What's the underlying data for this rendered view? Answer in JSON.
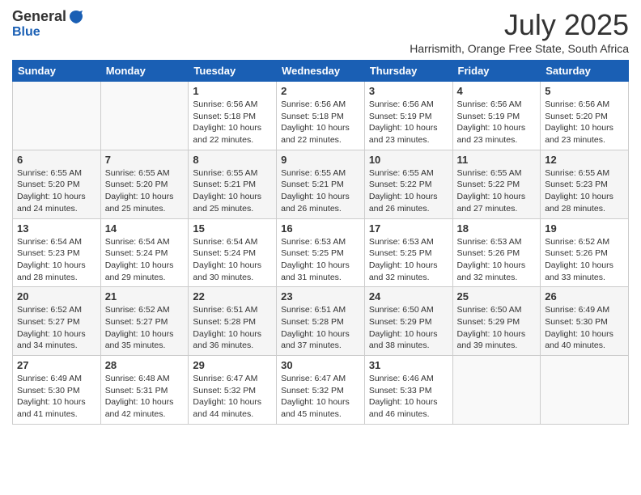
{
  "header": {
    "logo_general": "General",
    "logo_blue": "Blue",
    "month_title": "July 2025",
    "location": "Harrismith, Orange Free State, South Africa"
  },
  "weekdays": [
    "Sunday",
    "Monday",
    "Tuesday",
    "Wednesday",
    "Thursday",
    "Friday",
    "Saturday"
  ],
  "weeks": [
    [
      {
        "day": "",
        "info": ""
      },
      {
        "day": "",
        "info": ""
      },
      {
        "day": "1",
        "info": "Sunrise: 6:56 AM\nSunset: 5:18 PM\nDaylight: 10 hours and 22 minutes."
      },
      {
        "day": "2",
        "info": "Sunrise: 6:56 AM\nSunset: 5:18 PM\nDaylight: 10 hours and 22 minutes."
      },
      {
        "day": "3",
        "info": "Sunrise: 6:56 AM\nSunset: 5:19 PM\nDaylight: 10 hours and 23 minutes."
      },
      {
        "day": "4",
        "info": "Sunrise: 6:56 AM\nSunset: 5:19 PM\nDaylight: 10 hours and 23 minutes."
      },
      {
        "day": "5",
        "info": "Sunrise: 6:56 AM\nSunset: 5:20 PM\nDaylight: 10 hours and 23 minutes."
      }
    ],
    [
      {
        "day": "6",
        "info": "Sunrise: 6:55 AM\nSunset: 5:20 PM\nDaylight: 10 hours and 24 minutes."
      },
      {
        "day": "7",
        "info": "Sunrise: 6:55 AM\nSunset: 5:20 PM\nDaylight: 10 hours and 25 minutes."
      },
      {
        "day": "8",
        "info": "Sunrise: 6:55 AM\nSunset: 5:21 PM\nDaylight: 10 hours and 25 minutes."
      },
      {
        "day": "9",
        "info": "Sunrise: 6:55 AM\nSunset: 5:21 PM\nDaylight: 10 hours and 26 minutes."
      },
      {
        "day": "10",
        "info": "Sunrise: 6:55 AM\nSunset: 5:22 PM\nDaylight: 10 hours and 26 minutes."
      },
      {
        "day": "11",
        "info": "Sunrise: 6:55 AM\nSunset: 5:22 PM\nDaylight: 10 hours and 27 minutes."
      },
      {
        "day": "12",
        "info": "Sunrise: 6:55 AM\nSunset: 5:23 PM\nDaylight: 10 hours and 28 minutes."
      }
    ],
    [
      {
        "day": "13",
        "info": "Sunrise: 6:54 AM\nSunset: 5:23 PM\nDaylight: 10 hours and 28 minutes."
      },
      {
        "day": "14",
        "info": "Sunrise: 6:54 AM\nSunset: 5:24 PM\nDaylight: 10 hours and 29 minutes."
      },
      {
        "day": "15",
        "info": "Sunrise: 6:54 AM\nSunset: 5:24 PM\nDaylight: 10 hours and 30 minutes."
      },
      {
        "day": "16",
        "info": "Sunrise: 6:53 AM\nSunset: 5:25 PM\nDaylight: 10 hours and 31 minutes."
      },
      {
        "day": "17",
        "info": "Sunrise: 6:53 AM\nSunset: 5:25 PM\nDaylight: 10 hours and 32 minutes."
      },
      {
        "day": "18",
        "info": "Sunrise: 6:53 AM\nSunset: 5:26 PM\nDaylight: 10 hours and 32 minutes."
      },
      {
        "day": "19",
        "info": "Sunrise: 6:52 AM\nSunset: 5:26 PM\nDaylight: 10 hours and 33 minutes."
      }
    ],
    [
      {
        "day": "20",
        "info": "Sunrise: 6:52 AM\nSunset: 5:27 PM\nDaylight: 10 hours and 34 minutes."
      },
      {
        "day": "21",
        "info": "Sunrise: 6:52 AM\nSunset: 5:27 PM\nDaylight: 10 hours and 35 minutes."
      },
      {
        "day": "22",
        "info": "Sunrise: 6:51 AM\nSunset: 5:28 PM\nDaylight: 10 hours and 36 minutes."
      },
      {
        "day": "23",
        "info": "Sunrise: 6:51 AM\nSunset: 5:28 PM\nDaylight: 10 hours and 37 minutes."
      },
      {
        "day": "24",
        "info": "Sunrise: 6:50 AM\nSunset: 5:29 PM\nDaylight: 10 hours and 38 minutes."
      },
      {
        "day": "25",
        "info": "Sunrise: 6:50 AM\nSunset: 5:29 PM\nDaylight: 10 hours and 39 minutes."
      },
      {
        "day": "26",
        "info": "Sunrise: 6:49 AM\nSunset: 5:30 PM\nDaylight: 10 hours and 40 minutes."
      }
    ],
    [
      {
        "day": "27",
        "info": "Sunrise: 6:49 AM\nSunset: 5:30 PM\nDaylight: 10 hours and 41 minutes."
      },
      {
        "day": "28",
        "info": "Sunrise: 6:48 AM\nSunset: 5:31 PM\nDaylight: 10 hours and 42 minutes."
      },
      {
        "day": "29",
        "info": "Sunrise: 6:47 AM\nSunset: 5:32 PM\nDaylight: 10 hours and 44 minutes."
      },
      {
        "day": "30",
        "info": "Sunrise: 6:47 AM\nSunset: 5:32 PM\nDaylight: 10 hours and 45 minutes."
      },
      {
        "day": "31",
        "info": "Sunrise: 6:46 AM\nSunset: 5:33 PM\nDaylight: 10 hours and 46 minutes."
      },
      {
        "day": "",
        "info": ""
      },
      {
        "day": "",
        "info": ""
      }
    ]
  ]
}
